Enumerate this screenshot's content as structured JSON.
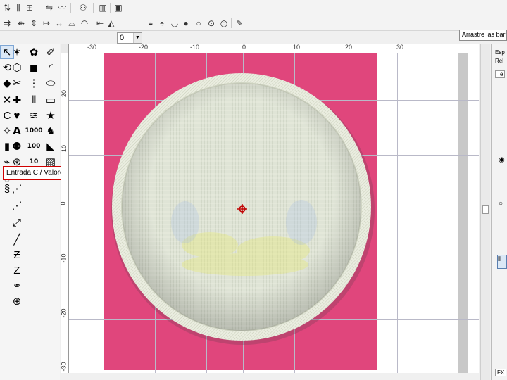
{
  "toolbar": {
    "combo_value": "0"
  },
  "hint_text": "Arrastre las barras",
  "tooltip": {
    "text": "Entrada C / Valores"
  },
  "toolbox": {
    "text_tools": [
      "A",
      "1000",
      "100",
      "10"
    ]
  },
  "ruler": {
    "top_labels": [
      "-30",
      "-20",
      "-10",
      "0",
      "10",
      "20",
      "30"
    ],
    "left_labels": [
      "20",
      "10",
      "0",
      "-10",
      "-20",
      "-30"
    ]
  },
  "right_panel": {
    "labels": [
      "Esp",
      "Rel",
      "Te",
      "FX"
    ]
  },
  "colors": {
    "fabric": "#e0467c",
    "patch_thread": "#e2e6d8",
    "patch_border": "#eceee2",
    "tooltip_border": "#d00000",
    "center_mark": "#c00000"
  }
}
